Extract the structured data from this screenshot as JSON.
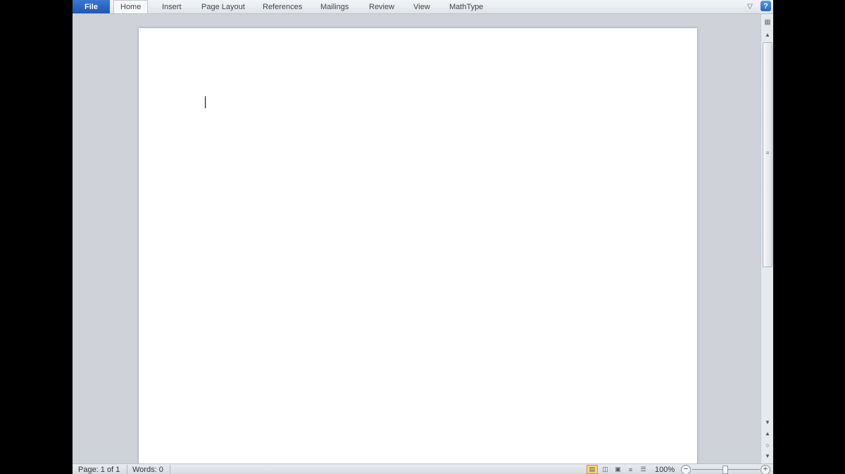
{
  "ribbon": {
    "file_label": "File",
    "tabs": [
      {
        "label": "Home"
      },
      {
        "label": "Insert"
      },
      {
        "label": "Page Layout"
      },
      {
        "label": "References"
      },
      {
        "label": "Mailings"
      },
      {
        "label": "Review"
      },
      {
        "label": "View"
      },
      {
        "label": "MathType"
      }
    ],
    "help_label": "?",
    "minimize_icon": "chevron-down-icon"
  },
  "statusbar": {
    "page": "Page: 1 of 1",
    "words": "Words: 0",
    "zoom": "100%",
    "zoom_out": "−",
    "zoom_in": "+"
  },
  "colors": {
    "file_tab": "#2a63c4",
    "workspace": "#cfd3d9",
    "active_view": "#f8d680"
  }
}
